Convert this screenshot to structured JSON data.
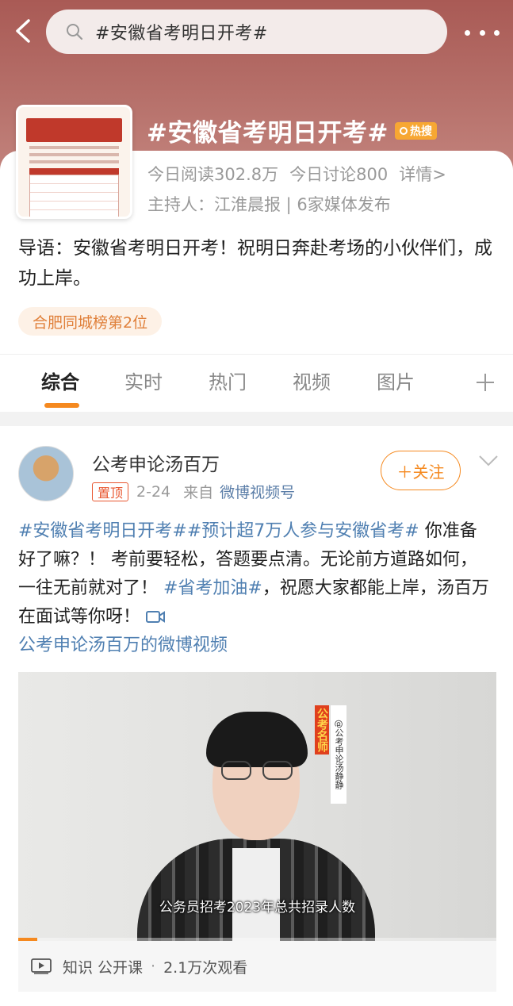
{
  "header": {
    "search_query": "#安徽省考明日开考#"
  },
  "topic": {
    "title": "#安徽省考明日开考#",
    "hot_badge": "热搜",
    "reads": "今日阅读302.8万",
    "discussions": "今日讨论800",
    "details": "详情>",
    "host": "主持人：江淮晨报 | 6家媒体发布",
    "intro": "导语：安徽省考明日开考！祝明日奔赴考场的小伙伴们，成功上岸。",
    "rank_badge": "合肥同城榜第2位"
  },
  "tabs": [
    "综合",
    "实时",
    "热门",
    "视频",
    "图片"
  ],
  "post": {
    "username": "公考申论汤百万",
    "pinned": "置顶",
    "date": "2-24",
    "from": "来自",
    "source": "微博视频号",
    "follow": "＋关注",
    "text_tag1": "#安徽省考明日开考#",
    "text_tag2": "#预计超7万人参与安徽省考#",
    "text_mid": " 你准备好了嘛？！ 考前要轻松，答题要点清。无论前方道路如何，一往无前就对了！ ",
    "text_tag3": "#省考加油#",
    "text_end": "，祝愿大家都能上岸，汤百万在面试等你呀！ ",
    "video_link": "公考申论汤百万的微博视频",
    "video_progress": 0.04,
    "video_subtitle": "公务员招考2023年总共招录人数",
    "video_label_red": "公考名师",
    "video_label_handle": "@公考申论汤静静",
    "video_category": "知识 公开课",
    "video_views": "2.1万次观看"
  },
  "colors": {
    "accent": "#f5891f",
    "link": "#4f7fb1",
    "hero": "#a95a55"
  },
  "icons": [
    "back-arrow-icon",
    "search-icon",
    "more-icon",
    "fire-pin-icon",
    "plus-icon",
    "chevron-down-icon",
    "video-icon",
    "play-icon"
  ]
}
